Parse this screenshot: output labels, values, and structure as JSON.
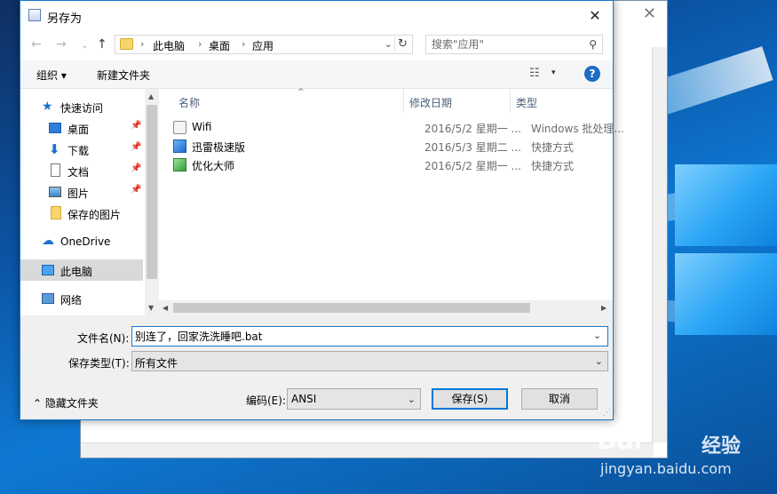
{
  "dialog": {
    "title": "另存为",
    "close_glyph": "✕"
  },
  "nav": {
    "back": "←",
    "forward": "→",
    "recent": "⌄",
    "up": "↑"
  },
  "address": {
    "crumbs": [
      "此电脑",
      "桌面",
      "应用"
    ],
    "separator": "›",
    "dropdown_glyph": "⌄",
    "refresh_glyph": "↻"
  },
  "search": {
    "placeholder": "搜索\"应用\"",
    "icon_glyph": "⚲"
  },
  "toolbar": {
    "organize_label": "组织 ▾",
    "new_folder_label": "新建文件夹",
    "view_glyph": "☷",
    "view_dropdown_glyph": "▾",
    "help_glyph": "?"
  },
  "navpane": {
    "items": [
      {
        "label": "快速访问",
        "pinned": false
      },
      {
        "label": "桌面",
        "pinned": true
      },
      {
        "label": "下载",
        "pinned": true
      },
      {
        "label": "文档",
        "pinned": true
      },
      {
        "label": "图片",
        "pinned": true
      },
      {
        "label": "保存的图片",
        "pinned": false
      },
      {
        "label": "OneDrive",
        "pinned": false
      },
      {
        "label": "此电脑",
        "pinned": false
      },
      {
        "label": "网络",
        "pinned": false
      }
    ],
    "pin_glyph": "📌",
    "selected": "此电脑"
  },
  "filelist": {
    "columns": [
      "名称",
      "修改日期",
      "类型"
    ],
    "sort_glyph": "^",
    "rows": [
      {
        "name": "Wifi",
        "date": "2016/5/2 星期一 ...",
        "type": "Windows 批处理..."
      },
      {
        "name": "迅雷极速版",
        "date": "2016/5/3 星期二 ...",
        "type": "快捷方式"
      },
      {
        "name": "优化大师",
        "date": "2016/5/2 星期一 ...",
        "type": "快捷方式"
      }
    ]
  },
  "form": {
    "filename_label": "文件名(N):",
    "filename_value": "别连了，回家洗洗睡吧.bat",
    "filetype_label": "保存类型(T):",
    "filetype_value": "所有文件",
    "encoding_label": "编码(E):",
    "encoding_value": "ANSI",
    "hide_folders_label": "⌃  隐藏文件夹",
    "save_label": "保存(S)",
    "cancel_label": "取消",
    "dropdown_glyph": "⌄"
  },
  "background_window": {
    "close_glyph": "✕"
  },
  "watermark": {
    "logo": "Bai",
    "suffix": "经验",
    "url": "jingyan.baidu.com"
  }
}
